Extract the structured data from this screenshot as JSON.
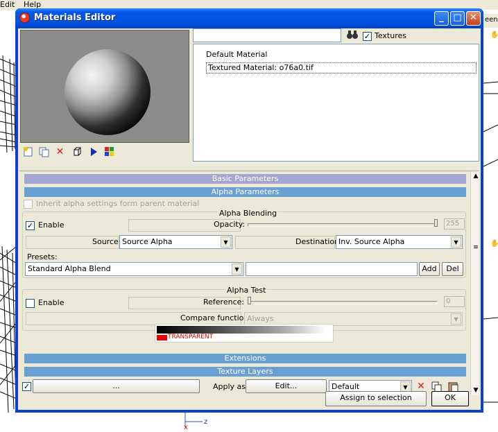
{
  "host": {
    "menu": [
      "Edit",
      "Help"
    ],
    "partial_text": "een"
  },
  "window": {
    "title": "Materials Editor",
    "controls": {
      "minimize": "_",
      "maximize": "□",
      "close": "✕"
    }
  },
  "search": {
    "value": ""
  },
  "textures": {
    "label": "Textures",
    "checked": true
  },
  "materials": [
    "Default Material",
    "Textured Material: o76a0.tif"
  ],
  "sections": {
    "basic": "Basic Parameters",
    "alpha": "Alpha Parameters",
    "extensions": "Extensions",
    "texture_layers": "Texture Layers"
  },
  "alpha": {
    "inherit_label": "Inherit alpha settings form parent material",
    "blending": {
      "title": "Alpha Blending",
      "enable_label": "Enable",
      "enable_checked": true,
      "opacity_label": "Opacity:",
      "opacity_value": "255",
      "source_label": "Source:",
      "source_value": "Source Alpha",
      "destination_label": "Destination:",
      "destination_value": "Inv. Source Alpha",
      "presets_label": "Presets:",
      "presets_value": "Standard Alpha Blend",
      "preset_name": "",
      "add_label": "Add",
      "del_label": "Del"
    },
    "test": {
      "title": "Alpha Test",
      "enable_label": "Enable",
      "enable_checked": false,
      "reference_label": "Reference:",
      "reference_value": "0",
      "compare_label": "Compare function:",
      "compare_value": "Always",
      "transparent_label": "TRANSPARENT"
    }
  },
  "texture_layer": {
    "checked": true,
    "browse_label": "...",
    "apply_as_label": "Apply as:",
    "edit_label": "Edit...",
    "mode_value": "Default"
  },
  "footer": {
    "assign_label": "Assign to selection",
    "ok_label": "OK"
  },
  "axis_label": "z"
}
